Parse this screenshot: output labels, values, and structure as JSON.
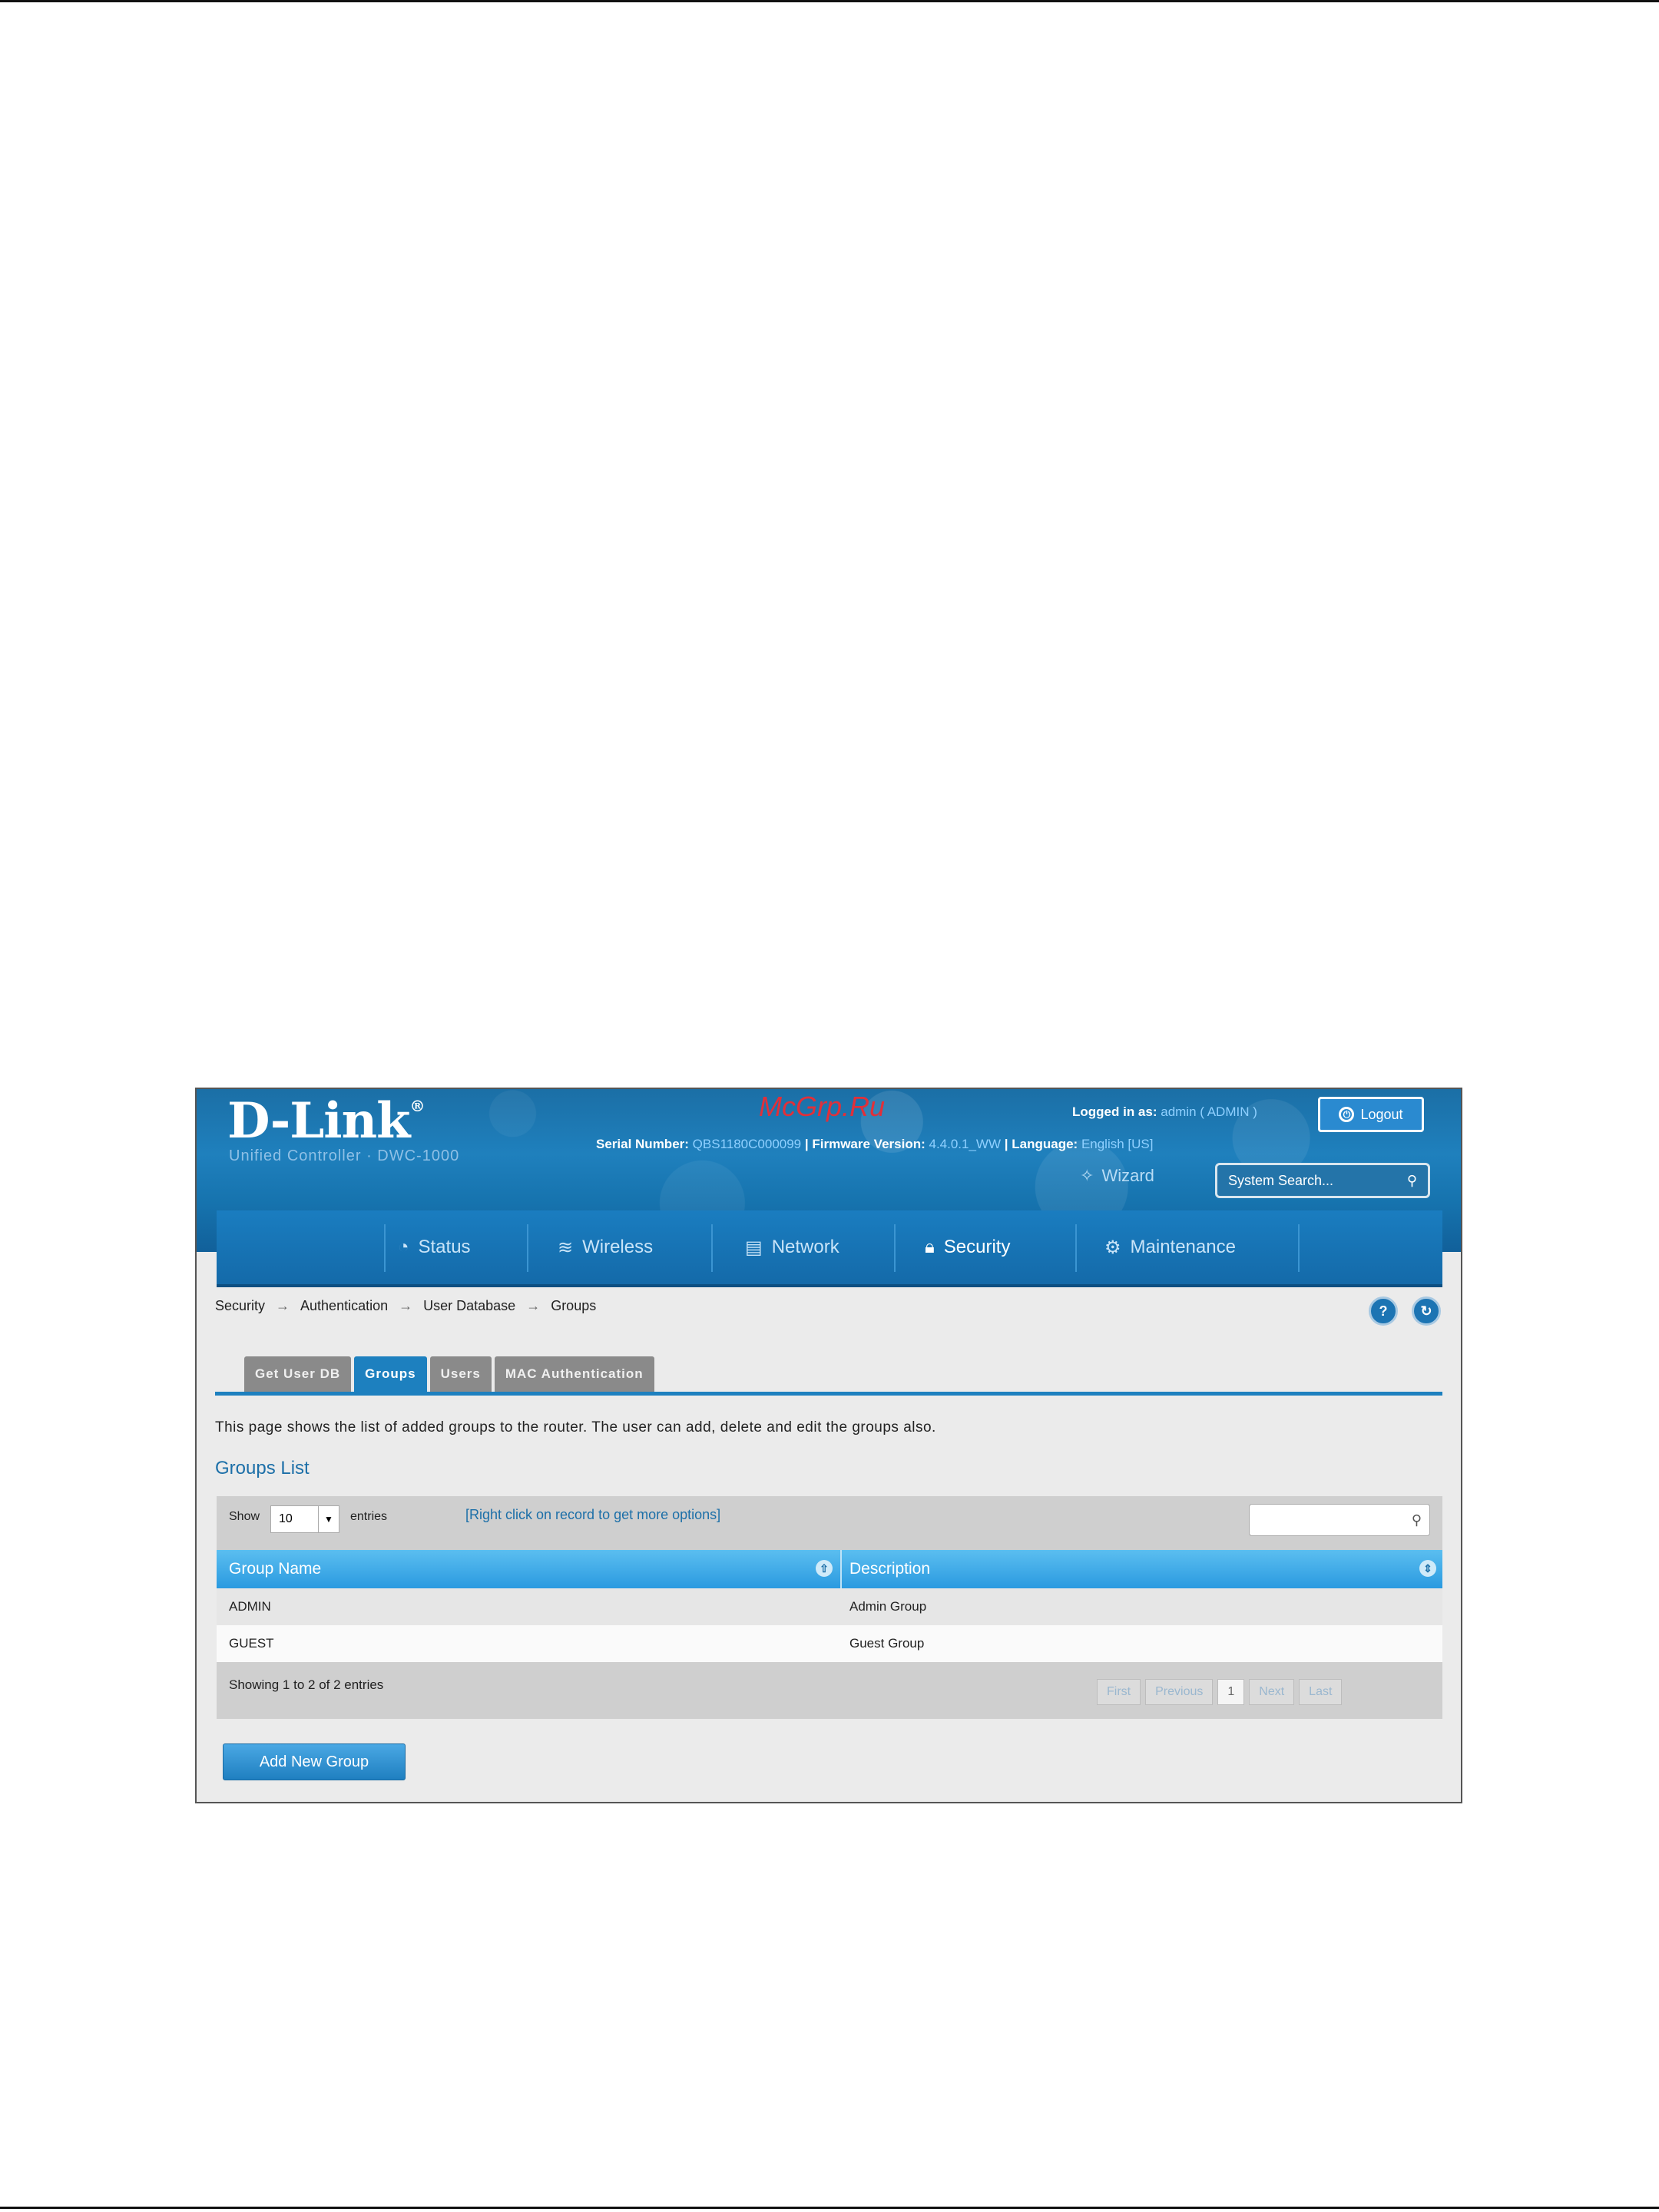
{
  "header": {
    "logo": "D-Link",
    "logo_mark": "®",
    "product": "Unified Controller · DWC-1000",
    "watermark": "McGrp.Ru",
    "logged_in_label": "Logged in as:",
    "logged_in_user": "admin ( ADMIN )",
    "logout_label": "Logout",
    "serial_label": "Serial Number:",
    "serial_value": "QBS1180C000099",
    "firmware_label": "Firmware Version:",
    "firmware_value": "4.4.0.1_WW",
    "language_label": "Language:",
    "language_value": "English [US]",
    "wizard_label": "Wizard",
    "search_placeholder": "System Search..."
  },
  "menu": [
    {
      "label": "Status",
      "icon": "gauge-icon"
    },
    {
      "label": "Wireless",
      "icon": "wifi-icon"
    },
    {
      "label": "Network",
      "icon": "network-icon"
    },
    {
      "label": "Security",
      "icon": "lock-icon",
      "active": true
    },
    {
      "label": "Maintenance",
      "icon": "gears-icon"
    }
  ],
  "breadcrumb": [
    "Security",
    "Authentication",
    "User Database",
    "Groups"
  ],
  "tabs": [
    "Get User DB",
    "Groups",
    "Users",
    "MAC Authentication"
  ],
  "intro": "This page shows the list of added groups to the router. The user can add, delete and edit the groups also.",
  "section_title": "Groups List",
  "table": {
    "show_label": "Show",
    "show_value": "10",
    "entries_label": "entries",
    "hint": "[Right click on record to get more options]",
    "columns": [
      "Group Name",
      "Description"
    ],
    "rows": [
      [
        "ADMIN",
        "Admin Group"
      ],
      [
        "GUEST",
        "Guest Group"
      ]
    ],
    "showing": "Showing 1 to 2 of 2 entries",
    "pager": [
      "First",
      "Previous",
      "1",
      "Next",
      "Last"
    ]
  },
  "add_button": "Add New Group",
  "colors": {
    "accent": "#1d80bf",
    "header": "#1b6fa6",
    "table_head": "#2a9ae0"
  }
}
